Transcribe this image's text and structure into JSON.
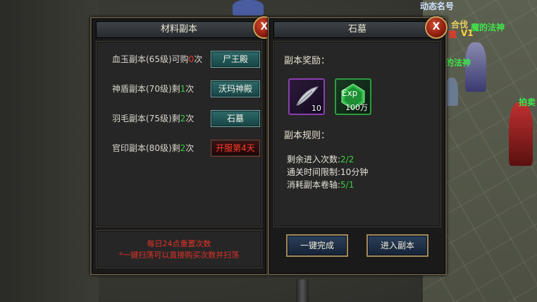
{
  "left_panel": {
    "title": "材料副本",
    "close_label": "X",
    "rows": [
      {
        "prefix": "血玉副本(65级)可购",
        "count": "0",
        "count_color": "red",
        "suffix": "次",
        "button": "尸王殿",
        "button_style": "teal"
      },
      {
        "prefix": "神盾副本(70级)剩",
        "count": "1",
        "count_color": "green",
        "suffix": "次",
        "button": "沃玛神殿",
        "button_style": "teal"
      },
      {
        "prefix": "羽毛副本(75级)剩",
        "count": "2",
        "count_color": "green",
        "suffix": "次",
        "button": "石墓",
        "button_style": "teal"
      },
      {
        "prefix": "官印副本(80级)剩",
        "count": "2",
        "count_color": "green",
        "suffix": "次",
        "button": "开服第4天",
        "button_style": "red"
      }
    ],
    "notice_line1": "每日24点重置次数",
    "notice_line2": "*一键扫荡可以直接购买次数并扫荡"
  },
  "right_panel": {
    "title": "石墓",
    "close_label": "X",
    "reward_title": "副本奖励：",
    "rewards": [
      {
        "icon": "feather-icon",
        "count": "10"
      },
      {
        "icon": "exp-gem-icon",
        "count": "100万",
        "icon_text": "Exp"
      }
    ],
    "rules_title": "副本规则：",
    "rules": [
      {
        "label": "剩余进入次数:",
        "value": "2/2",
        "highlight": true
      },
      {
        "label": "通关时间限制:",
        "value": "10分钟",
        "highlight": false
      },
      {
        "label": "消耗副本卷轴:",
        "value": "5/1",
        "highlight": true
      }
    ],
    "quick_button": "一键完成",
    "enter_button": "进入副本"
  },
  "background": {
    "player_name_1": "魔的法神",
    "player_tag_1": "V1",
    "player_prefix_1": "魔",
    "guild_fragment": "合伐",
    "player_name_2": "的法神",
    "top_text": "动态名号",
    "edge_text": "拍卖"
  },
  "colors": {
    "accent_red": "#e23a2a",
    "accent_green": "#36d23a",
    "teal_button": "#2e6a6a",
    "panel_border": "#5a5040"
  }
}
